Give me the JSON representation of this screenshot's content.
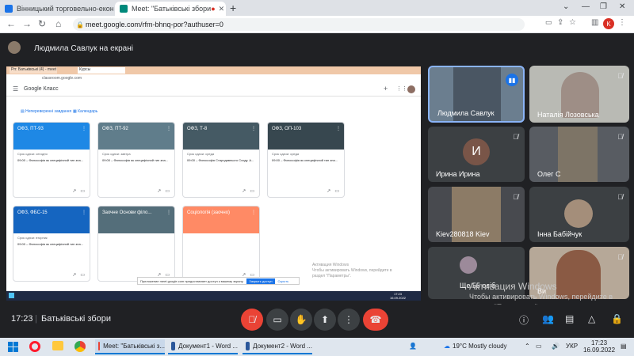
{
  "browser": {
    "tab1_title": "Вінницький торговельно-економ",
    "tab2_title": "Meet: \"Батьківські збори",
    "url": "meet.google.com/rfm-bhnq-por?authuser=0",
    "avatar_letter": "K"
  },
  "meet": {
    "presenting_label": "Людмила Савлук на екрані",
    "time": "17:23",
    "meeting_title": "Батьківські збори",
    "participants": [
      {
        "name": "Людмила Савлук"
      },
      {
        "name": "Наталія Лозовська"
      },
      {
        "name": "Ирина Ирина",
        "initial": "И"
      },
      {
        "name": "Олег С"
      },
      {
        "name": "Kiev280818 Kiev"
      },
      {
        "name": "Інна Бабійчук"
      },
      {
        "name": "Ще 55 осіб"
      },
      {
        "name": "Ви"
      }
    ],
    "watermark_line1": "Активация Windows",
    "watermark_line2": "Чтобы активировать Windows, перейдите в",
    "watermark_line3": "раздел \"Параметры\"."
  },
  "shared": {
    "app_name": "Google Класс",
    "nav_todo": "Непереверенні завдання",
    "nav_calendar": "Календарь",
    "classes": [
      {
        "title": "ОФЗ, ПТ-93",
        "color": "#1e88e5",
        "sub": "Срок сдачи: сегодня",
        "item": "09:00 – Философія як специфічний тип зна..."
      },
      {
        "title": "ОФЗ, ПТ-92",
        "color": "#607d8b",
        "sub": "Срок сдачи: завтра",
        "item": "09:00 – Философія як специфічний тип зна..."
      },
      {
        "title": "ОФЗ, Т-8",
        "color": "#455a64",
        "sub": "Срок сдачи: среда",
        "item": "09:00 – Философія Стародавнього Сходу. А..."
      },
      {
        "title": "ОФЗ, ОП-103",
        "color": "#37474f",
        "sub": "Срок сдачи: среда",
        "item": "09:00 – Философія як специфічний тип зна..."
      },
      {
        "title": "ОФЗ, ФБС-15",
        "color": "#1565c0",
        "sub": "Срок сдачи: вторник",
        "item": "09:00 – Философія як специфічний тип зна..."
      },
      {
        "title": "Заочне Основи філо...",
        "color": "#546e7a",
        "sub": "",
        "item": ""
      },
      {
        "title": "Соціологія (заочно)",
        "color": "#ff8a65",
        "sub": "",
        "item": ""
      }
    ],
    "inner_url": "classroom.google.com",
    "inner_tab": "Курсы",
    "notice": "Приложение meet.google.com предоставляет доступ к вашему экрану.",
    "notice_stop": "Закрыть доступ",
    "notice_hide": "Скрыть",
    "inner_watermark1": "Активация Windows",
    "inner_watermark2": "Чтобы активировать Windows, перейдите в",
    "inner_watermark3": "раздел \"Параметры\".",
    "inner_clock": "17:23",
    "inner_date": "16.09.2022"
  },
  "taskbar": {
    "apps": [
      {
        "label": "Meet: \"Батьківські з...",
        "color": "#ea4335"
      },
      {
        "label": "Документ1 - Word ...",
        "color": "#2b579a"
      },
      {
        "label": "Документ2 - Word ...",
        "color": "#2b579a"
      }
    ],
    "weather": "19°C  Mostly cloudy",
    "lang": "УКР",
    "clock_time": "17:23",
    "clock_date": "16.09.2022"
  }
}
